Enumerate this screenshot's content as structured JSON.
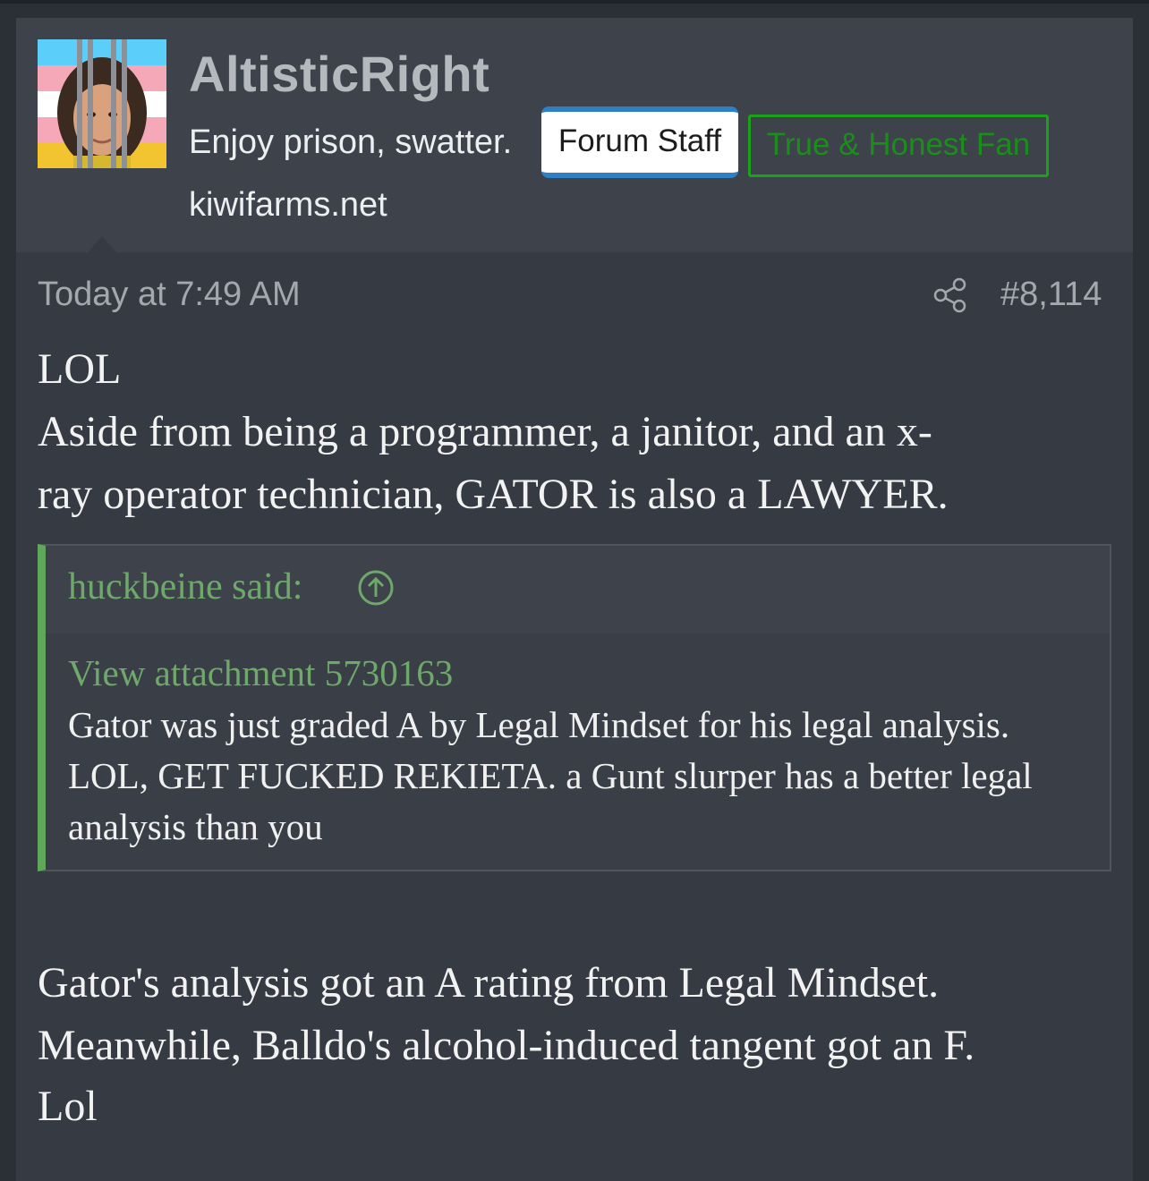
{
  "post": {
    "username": "AltisticRight",
    "user_title": "Enjoy prison, swatter.",
    "banner_staff": "Forum Staff",
    "banner_fan": "True & Honest Fan",
    "site": "kiwifarms.net",
    "timestamp": "Today at 7:49 AM",
    "post_number": "#8,114",
    "body_intro": "LOL",
    "body_line1": "Aside from being a programmer, a janitor, and an x-",
    "body_line2": "ray operator technician, GATOR is also a LAWYER.",
    "quote": {
      "author": "huckbeine said:",
      "attachment_link": "View attachment 5730163",
      "text": "Gator was just graded A by Legal Mindset for his legal analysis. LOL, GET FUCKED REKIETA. a Gunt slurper has a better legal analysis than you"
    },
    "body_outro_line1": "Gator's analysis got an A rating from Legal Mindset.",
    "body_outro_line2": "Meanwhile, Balldo's alcohol-induced tangent got an F.",
    "body_outro_line3": "Lol"
  },
  "icons": {
    "share": "share-icon",
    "quote_jump": "arrow-up-circle-icon",
    "avatar": "avatar"
  },
  "colors": {
    "staff_banner_accent": "#2f7fc4",
    "fan_banner": "#1aa31a",
    "quote_accent": "#5fa85a"
  }
}
